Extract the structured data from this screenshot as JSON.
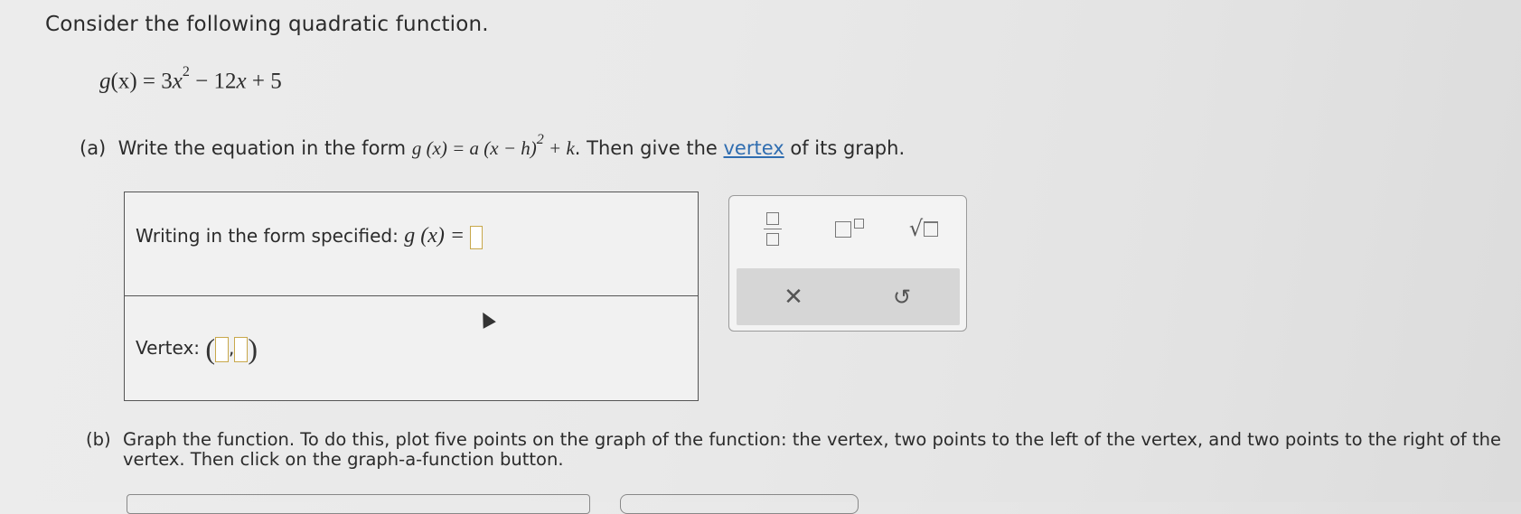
{
  "intro": "Consider the following quadratic function.",
  "function": {
    "lhs": "g",
    "arg": "(x)",
    "eq": " = 3",
    "var1": "x",
    "exp": "2",
    "minus": " − 12",
    "var2": "x",
    "tail": " + 5"
  },
  "part_a": {
    "label": "(a)",
    "text_before": "Write the equation in the form ",
    "form": "g (x) = a (x − h)",
    "form_exp": "2",
    "form_tail": " + k",
    "text_mid": ". Then give the ",
    "link": "vertex",
    "text_after": " of its graph."
  },
  "answer": {
    "form_label": "Writing in the form specified:",
    "form_lhs": "g (x) =",
    "vertex_label": "Vertex:",
    "vertex_comma": ","
  },
  "toolbar": {
    "fraction_icon": "fraction-icon",
    "exponent_icon": "exponent-icon",
    "sqrt_symbol": "√",
    "clear_symbol": "✕",
    "undo_symbol": "↺"
  },
  "part_b": {
    "label": "(b)",
    "text": "Graph the function. To do this, plot five points on the graph of the function: the vertex, two points to the left of the vertex, and two points to the right of the vertex. Then click on the graph-a-function button."
  }
}
